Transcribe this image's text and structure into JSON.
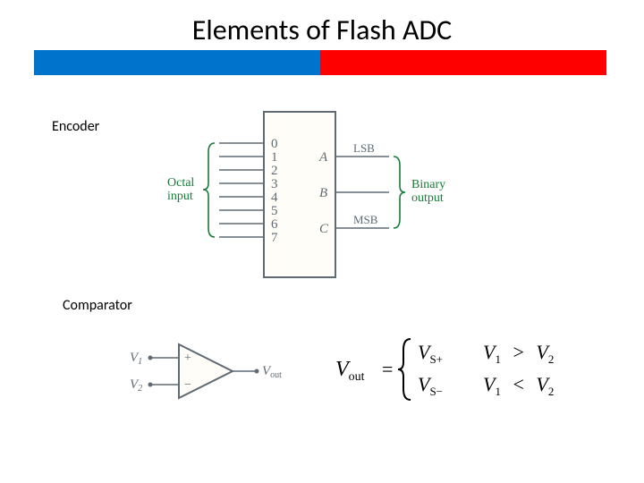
{
  "title": "Elements of Flash ADC",
  "sections": {
    "encoder": "Encoder",
    "comparator": "Comparator"
  },
  "encoder": {
    "input_label": "Octal\ninput",
    "output_label": "Binary\noutput",
    "inputs": [
      "0",
      "1",
      "2",
      "3",
      "4",
      "5",
      "6",
      "7"
    ],
    "outputs": [
      {
        "pin": "A",
        "role": "LSB"
      },
      {
        "pin": "B",
        "role": ""
      },
      {
        "pin": "C",
        "role": "MSB"
      }
    ]
  },
  "comparator": {
    "in_pos": "V",
    "in_pos_sub": "1",
    "in_neg": "V",
    "in_neg_sub": "2",
    "out": "V",
    "out_sub": "out",
    "plus": "+",
    "minus": "−"
  },
  "equation": {
    "lhs": "V",
    "lhs_sub": "out",
    "eq": "=",
    "cases": [
      {
        "val": "V",
        "val_sub": "S+",
        "cond_l": "V",
        "cond_l_sub": "1",
        "op": ">",
        "cond_r": "V",
        "cond_r_sub": "2"
      },
      {
        "val": "V",
        "val_sub": "S−",
        "cond_l": "V",
        "cond_l_sub": "1",
        "op": "<",
        "cond_r": "V",
        "cond_r_sub": "2"
      }
    ]
  },
  "chart_data": {
    "type": "diagram",
    "encoder": {
      "inputs": 8,
      "outputs": 3,
      "input_radix": "octal",
      "output_radix": "binary",
      "bit_order": {
        "A": "LSB",
        "C": "MSB"
      }
    },
    "comparator_truth": [
      {
        "condition": "V1 > V2",
        "Vout": "VS+"
      },
      {
        "condition": "V1 < V2",
        "Vout": "VS−"
      }
    ]
  }
}
